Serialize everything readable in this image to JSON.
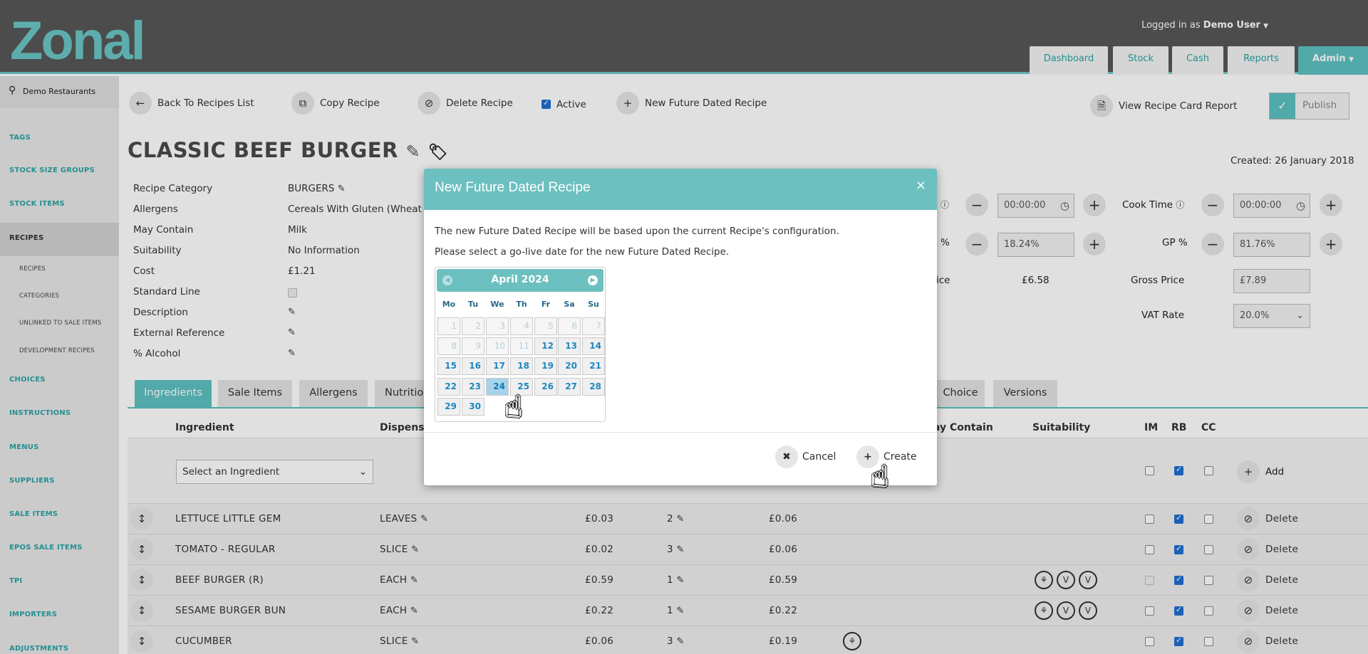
{
  "header": {
    "logo": "Zonal",
    "login_prefix": "Logged in as",
    "login_user": "Demo User",
    "nav": [
      "Dashboard",
      "Stock",
      "Cash",
      "Reports",
      "Admin"
    ]
  },
  "sidebar": {
    "location": "Demo Restaurants",
    "items": [
      "TAGS",
      "STOCK SIZE GROUPS",
      "STOCK ITEMS",
      "RECIPES"
    ],
    "sub_items": [
      "RECIPES",
      "CATEGORIES",
      "UNLINKED TO SALE ITEMS",
      "DEVELOPMENT RECIPES"
    ],
    "items_after": [
      "CHOICES",
      "INSTRUCTIONS",
      "MENUS",
      "SUPPLIERS",
      "SALE ITEMS",
      "EPOS SALE ITEMS",
      "TPI",
      "IMPORTERS",
      "ADJUSTMENTS"
    ]
  },
  "toolbar": {
    "back": "Back To Recipes List",
    "copy": "Copy Recipe",
    "delete": "Delete Recipe",
    "active": "Active",
    "new_future": "New Future Dated Recipe",
    "view_report": "View Recipe Card Report",
    "publish": "Publish"
  },
  "recipe": {
    "title": "CLASSIC BEEF BURGER",
    "created": "Created: 26 January 2018",
    "labels": [
      "Recipe Category",
      "Allergens",
      "May Contain",
      "Suitability",
      "Cost",
      "Standard Line",
      "Description",
      "External Reference",
      "% Alcohol"
    ],
    "category": "BURGERS",
    "allergens": "Cereals With Gluten (Wheat",
    "may_contain": "Milk",
    "suitability": "No Information",
    "cost": "£1.21"
  },
  "right_fields": {
    "prep_time": "00:00:00",
    "cook_time_label": "Cook Time",
    "cook_time": "00:00:00",
    "percent_label": "%",
    "percent_value": "18.24%",
    "gp_label": "GP %",
    "gp_value": "81.76%",
    "price_label_partial": "ice",
    "price_value": "£6.58",
    "gross_price_label": "Gross Price",
    "gross_price": "£7.89",
    "vat_label": "VAT Rate",
    "vat_value": "20.0%"
  },
  "tabs": [
    "Ingredients",
    "Sale Items",
    "Allergens",
    "Nutritio",
    "Choice",
    "Versions"
  ],
  "table": {
    "headers": [
      "Ingredient",
      "Dispense",
      "ay Contain",
      "Suitability",
      "IM",
      "RB",
      "CC"
    ],
    "select_placeholder": "Select an Ingredient",
    "add_label": "Add",
    "delete_label": "Delete",
    "rows": [
      {
        "name": "LETTUCE LITTLE GEM",
        "dispense": "LEAVES",
        "cost": "£0.03",
        "qty": "2",
        "total": "£0.06"
      },
      {
        "name": "TOMATO - REGULAR",
        "dispense": "SLICE",
        "cost": "£0.02",
        "qty": "3",
        "total": "£0.06"
      },
      {
        "name": "BEEF BURGER (R)",
        "dispense": "EACH",
        "cost": "£0.59",
        "qty": "1",
        "total": "£0.59"
      },
      {
        "name": "SESAME BURGER BUN",
        "dispense": "EACH",
        "cost": "£0.22",
        "qty": "1",
        "total": "£0.22"
      },
      {
        "name": "CUCUMBER",
        "dispense": "SLICE",
        "cost": "£0.06",
        "qty": "3",
        "total": "£0.19"
      }
    ]
  },
  "modal": {
    "title": "New Future Dated Recipe",
    "close": "×",
    "line1": "The new Future Dated Recipe will be based upon the current Recipe's configuration.",
    "line2": "Please select a go-live date for the new Future Dated Recipe.",
    "calendar": {
      "month": "April 2024",
      "weekdays": [
        "Mo",
        "Tu",
        "We",
        "Th",
        "Fr",
        "Sa",
        "Su"
      ],
      "selected_day": 24,
      "first_enabled_day": 12
    },
    "cancel": "Cancel",
    "create": "Create"
  },
  "colors": {
    "accent": "#6cc0bf",
    "header_bg": "#575757",
    "link": "#2aa3a3"
  }
}
